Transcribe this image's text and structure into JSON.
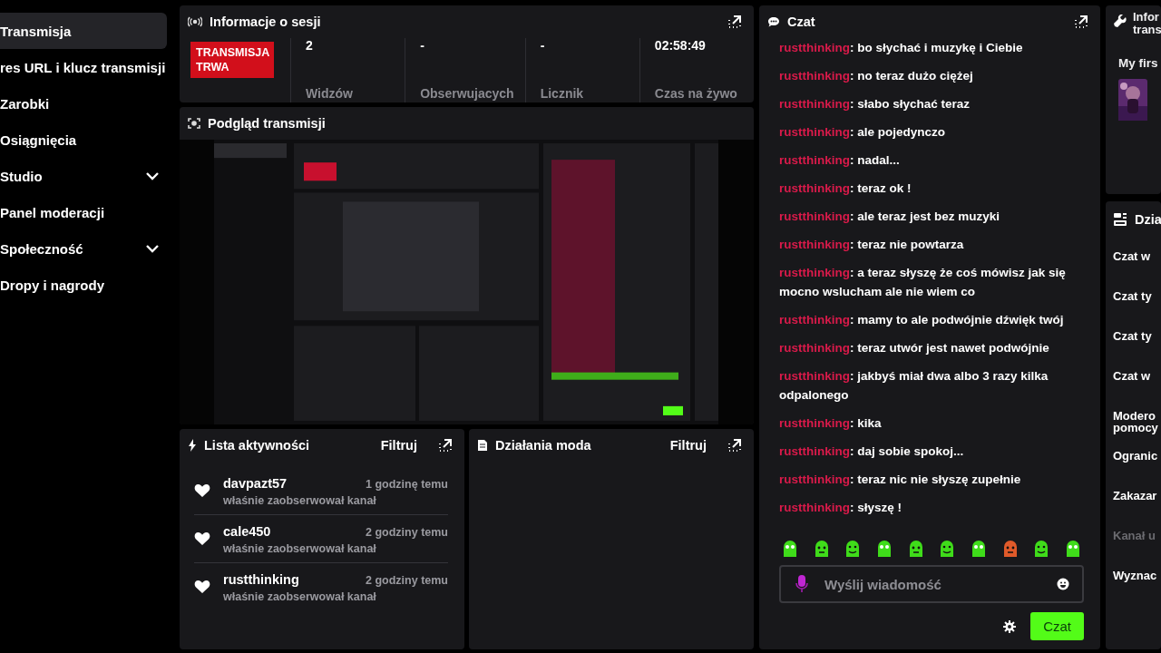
{
  "sidebar": {
    "items": [
      {
        "label": "Transmisja",
        "kind": "link",
        "selected": true
      },
      {
        "label": "res URL i klucz transmisji",
        "kind": "link",
        "selected": false
      },
      {
        "label": "Zarobki",
        "kind": "link",
        "selected": false
      },
      {
        "label": "Osiągnięcia",
        "kind": "link",
        "selected": false
      },
      {
        "label": "Studio",
        "kind": "group",
        "selected": false,
        "expanded": false
      },
      {
        "label": "Panel moderacji",
        "kind": "link",
        "selected": false
      },
      {
        "label": "Społeczność",
        "kind": "group",
        "selected": false,
        "expanded": false
      },
      {
        "label": "Dropy i nagrody",
        "kind": "link",
        "selected": false
      }
    ]
  },
  "session": {
    "title": "Informacje o sesji",
    "live_badge": "TRANSMISJA TRWA",
    "stats": [
      {
        "value": "2",
        "label": "Widzów"
      },
      {
        "value": "-",
        "label": "Obserwujacych"
      },
      {
        "value": "-",
        "label": "Licznik"
      },
      {
        "value": "02:58:49",
        "label": "Czas na żywo"
      }
    ]
  },
  "preview": {
    "title": "Podgląd transmisji",
    "kind": "picture"
  },
  "activity": {
    "title": "Lista aktywności",
    "filter": "Filtruj",
    "items": [
      {
        "name": "davpazt57",
        "time": "1 godzinę temu",
        "text": "właśnie zaobserwował kanał"
      },
      {
        "name": "cale450",
        "time": "2 godziny temu",
        "text": "właśnie zaobserwował kanał"
      },
      {
        "name": "rustthinking",
        "time": "2 godziny temu",
        "text": "właśnie zaobserwował kanał"
      }
    ]
  },
  "mod_actions": {
    "title": "Działania moda",
    "filter": "Filtruj"
  },
  "chat": {
    "title": "Czat",
    "messages": [
      {
        "user": "rustthinking",
        "text": ": bo słychać i muzykę i Ciebie"
      },
      {
        "user": "rustthinking",
        "text": ": no teraz dużo ciężej"
      },
      {
        "user": "rustthinking",
        "text": ": słabo słychać teraz"
      },
      {
        "user": "rustthinking",
        "text": ": ale pojedynczo"
      },
      {
        "user": "rustthinking",
        "text": ": nadal..."
      },
      {
        "user": "rustthinking",
        "text": ": teraz ok !"
      },
      {
        "user": "rustthinking",
        "text": ": ale teraz jest bez muzyki"
      },
      {
        "user": "rustthinking",
        "text": ": teraz nie powtarza"
      },
      {
        "user": "rustthinking",
        "text": ": a teraz słyszę że coś mówisz jak się mocno wslucham ale nie wiem co"
      },
      {
        "user": "rustthinking",
        "text": ": mamy to ale podwójnie dźwięk twój"
      },
      {
        "user": "rustthinking",
        "text": ": teraz utwór jest nawet podwójnie"
      },
      {
        "user": "rustthinking",
        "text": ": jakbyś miał dwa albo 3 razy kilka odpalonego"
      },
      {
        "user": "rustthinking",
        "text": ": kika"
      },
      {
        "user": "rustthinking",
        "text": ": daj sobie spokoj..."
      },
      {
        "user": "rustthinking",
        "text": ": teraz nic nie słyszę zupełnie"
      },
      {
        "user": "rustthinking",
        "text": ": słyszę !"
      }
    ],
    "input": {
      "placeholder": "Wyślij wiadomość"
    },
    "send": "Czat"
  },
  "stream_info": {
    "title_lines": [
      "Infor",
      "trans"
    ],
    "stream_title": "My firs"
  },
  "mod_panel": {
    "title": "Dzia",
    "items": [
      {
        "label": "Czat w",
        "disabled": false
      },
      {
        "label": "Czat ty",
        "disabled": false
      },
      {
        "label": "Czat ty",
        "disabled": false
      },
      {
        "label": "Czat w",
        "disabled": false
      },
      {
        "label": "Modero pomocy",
        "disabled": false
      },
      {
        "label": "Ogranic",
        "disabled": false
      },
      {
        "label": "Zakazar",
        "disabled": false
      },
      {
        "label": "Kanał u",
        "disabled": true
      },
      {
        "label": "Wyznac",
        "disabled": false
      }
    ]
  }
}
